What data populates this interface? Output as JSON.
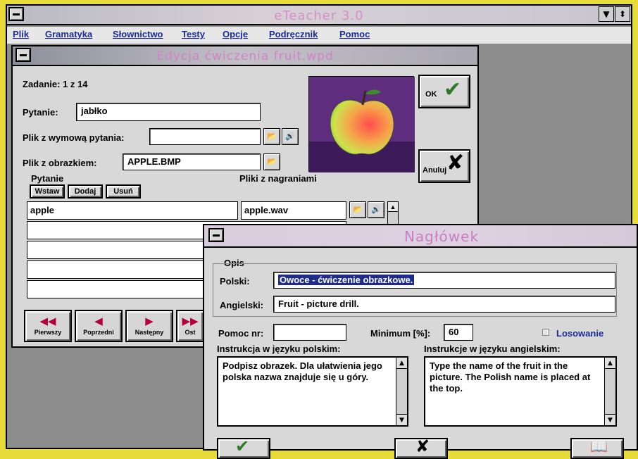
{
  "app": {
    "title": "eTeacher 3.0",
    "menu": [
      "Plik",
      "Gramatyka",
      "Słownictwo",
      "Testy",
      "Opcje",
      "Podręcznik",
      "Pomoc"
    ]
  },
  "editor": {
    "title": "Edycja ćwiczenia fruit.wpd",
    "task_label": "Zadanie: 1 z 14",
    "question_label": "Pytanie:",
    "question_value": "jabłko",
    "question_audio_label": "Plik z wymową pytania:",
    "question_audio_value": "",
    "image_label": "Plik z obrazkiem:",
    "image_value": "APPLE.BMP",
    "answers_group": "Pytanie",
    "recordings_label": "Pliki z nagraniami",
    "buttons": {
      "insert": "Wstaw",
      "add": "Dodaj",
      "delete": "Usuń",
      "ok": "OK",
      "cancel": "Anuluj"
    },
    "answers": [
      {
        "text": "apple",
        "file": "apple.wav"
      },
      {
        "text": "",
        "file": ""
      },
      {
        "text": "",
        "file": ""
      },
      {
        "text": "",
        "file": ""
      },
      {
        "text": "",
        "file": ""
      }
    ],
    "nav": [
      {
        "label": "Pierwszy",
        "arrow": "◀◀"
      },
      {
        "label": "Poprzedni",
        "arrow": "◀"
      },
      {
        "label": "Następny",
        "arrow": "▶"
      },
      {
        "label": "Ost",
        "arrow": "▶▶"
      }
    ]
  },
  "header_dialog": {
    "title": "Nagłówek",
    "group": "Opis",
    "polish_label": "Polski:",
    "polish_value": "Owoce - ćwiczenie obrazkowe.",
    "english_label": "Angielski:",
    "english_value": "Fruit - picture drill.",
    "help_label": "Pomoc nr:",
    "help_value": "",
    "minimum_label": "Minimum [%]:",
    "minimum_value": "60",
    "random_label": "Losowanie",
    "instr_pl_label": "Instrukcja w języku polskim:",
    "instr_pl_value": "Podpisz obrazek. Dla ułatwienia jego polska nazwa znajduje się u góry.",
    "instr_en_label": "Instrukcje w języku angielskim:",
    "instr_en_value": "Type the name of the fruit in the picture. The Polish name is placed at the top."
  },
  "colors": {
    "desktop": "#e8dc3a",
    "menu_text": "#1c2a9a",
    "title_text": "#d084c6",
    "check": "#2f7a2a",
    "cross": "#000000"
  }
}
